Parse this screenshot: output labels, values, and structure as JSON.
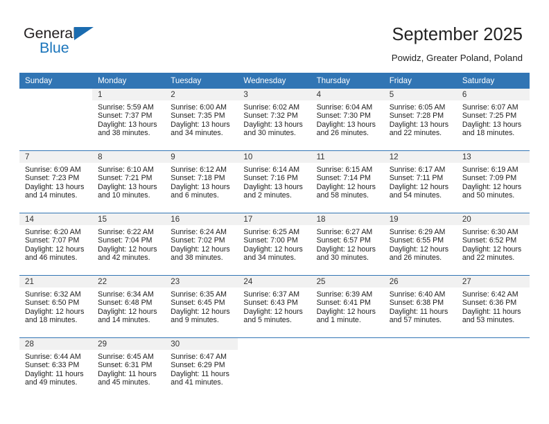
{
  "brand": {
    "name_part1": "General",
    "name_part2": "Blue",
    "logo_icon": "triangle-flag-icon",
    "accent_color": "#1b75bb"
  },
  "header": {
    "title": "September 2025",
    "subtitle": "Powidz, Greater Poland, Poland"
  },
  "calendar": {
    "header_bg_color": "#3175b4",
    "daynum_bg_color": "#f1f1f1",
    "weekday_headers": [
      "Sunday",
      "Monday",
      "Tuesday",
      "Wednesday",
      "Thursday",
      "Friday",
      "Saturday"
    ],
    "weeks": [
      [
        {
          "day": "",
          "sunrise": "",
          "sunset": "",
          "daylight_line1": "",
          "daylight_line2": "",
          "blank": true
        },
        {
          "day": "1",
          "sunrise": "Sunrise: 5:59 AM",
          "sunset": "Sunset: 7:37 PM",
          "daylight_line1": "Daylight: 13 hours",
          "daylight_line2": "and 38 minutes."
        },
        {
          "day": "2",
          "sunrise": "Sunrise: 6:00 AM",
          "sunset": "Sunset: 7:35 PM",
          "daylight_line1": "Daylight: 13 hours",
          "daylight_line2": "and 34 minutes."
        },
        {
          "day": "3",
          "sunrise": "Sunrise: 6:02 AM",
          "sunset": "Sunset: 7:32 PM",
          "daylight_line1": "Daylight: 13 hours",
          "daylight_line2": "and 30 minutes."
        },
        {
          "day": "4",
          "sunrise": "Sunrise: 6:04 AM",
          "sunset": "Sunset: 7:30 PM",
          "daylight_line1": "Daylight: 13 hours",
          "daylight_line2": "and 26 minutes."
        },
        {
          "day": "5",
          "sunrise": "Sunrise: 6:05 AM",
          "sunset": "Sunset: 7:28 PM",
          "daylight_line1": "Daylight: 13 hours",
          "daylight_line2": "and 22 minutes."
        },
        {
          "day": "6",
          "sunrise": "Sunrise: 6:07 AM",
          "sunset": "Sunset: 7:25 PM",
          "daylight_line1": "Daylight: 13 hours",
          "daylight_line2": "and 18 minutes."
        }
      ],
      [
        {
          "day": "7",
          "sunrise": "Sunrise: 6:09 AM",
          "sunset": "Sunset: 7:23 PM",
          "daylight_line1": "Daylight: 13 hours",
          "daylight_line2": "and 14 minutes."
        },
        {
          "day": "8",
          "sunrise": "Sunrise: 6:10 AM",
          "sunset": "Sunset: 7:21 PM",
          "daylight_line1": "Daylight: 13 hours",
          "daylight_line2": "and 10 minutes."
        },
        {
          "day": "9",
          "sunrise": "Sunrise: 6:12 AM",
          "sunset": "Sunset: 7:18 PM",
          "daylight_line1": "Daylight: 13 hours",
          "daylight_line2": "and 6 minutes."
        },
        {
          "day": "10",
          "sunrise": "Sunrise: 6:14 AM",
          "sunset": "Sunset: 7:16 PM",
          "daylight_line1": "Daylight: 13 hours",
          "daylight_line2": "and 2 minutes."
        },
        {
          "day": "11",
          "sunrise": "Sunrise: 6:15 AM",
          "sunset": "Sunset: 7:14 PM",
          "daylight_line1": "Daylight: 12 hours",
          "daylight_line2": "and 58 minutes."
        },
        {
          "day": "12",
          "sunrise": "Sunrise: 6:17 AM",
          "sunset": "Sunset: 7:11 PM",
          "daylight_line1": "Daylight: 12 hours",
          "daylight_line2": "and 54 minutes."
        },
        {
          "day": "13",
          "sunrise": "Sunrise: 6:19 AM",
          "sunset": "Sunset: 7:09 PM",
          "daylight_line1": "Daylight: 12 hours",
          "daylight_line2": "and 50 minutes."
        }
      ],
      [
        {
          "day": "14",
          "sunrise": "Sunrise: 6:20 AM",
          "sunset": "Sunset: 7:07 PM",
          "daylight_line1": "Daylight: 12 hours",
          "daylight_line2": "and 46 minutes."
        },
        {
          "day": "15",
          "sunrise": "Sunrise: 6:22 AM",
          "sunset": "Sunset: 7:04 PM",
          "daylight_line1": "Daylight: 12 hours",
          "daylight_line2": "and 42 minutes."
        },
        {
          "day": "16",
          "sunrise": "Sunrise: 6:24 AM",
          "sunset": "Sunset: 7:02 PM",
          "daylight_line1": "Daylight: 12 hours",
          "daylight_line2": "and 38 minutes."
        },
        {
          "day": "17",
          "sunrise": "Sunrise: 6:25 AM",
          "sunset": "Sunset: 7:00 PM",
          "daylight_line1": "Daylight: 12 hours",
          "daylight_line2": "and 34 minutes."
        },
        {
          "day": "18",
          "sunrise": "Sunrise: 6:27 AM",
          "sunset": "Sunset: 6:57 PM",
          "daylight_line1": "Daylight: 12 hours",
          "daylight_line2": "and 30 minutes."
        },
        {
          "day": "19",
          "sunrise": "Sunrise: 6:29 AM",
          "sunset": "Sunset: 6:55 PM",
          "daylight_line1": "Daylight: 12 hours",
          "daylight_line2": "and 26 minutes."
        },
        {
          "day": "20",
          "sunrise": "Sunrise: 6:30 AM",
          "sunset": "Sunset: 6:52 PM",
          "daylight_line1": "Daylight: 12 hours",
          "daylight_line2": "and 22 minutes."
        }
      ],
      [
        {
          "day": "21",
          "sunrise": "Sunrise: 6:32 AM",
          "sunset": "Sunset: 6:50 PM",
          "daylight_line1": "Daylight: 12 hours",
          "daylight_line2": "and 18 minutes."
        },
        {
          "day": "22",
          "sunrise": "Sunrise: 6:34 AM",
          "sunset": "Sunset: 6:48 PM",
          "daylight_line1": "Daylight: 12 hours",
          "daylight_line2": "and 14 minutes."
        },
        {
          "day": "23",
          "sunrise": "Sunrise: 6:35 AM",
          "sunset": "Sunset: 6:45 PM",
          "daylight_line1": "Daylight: 12 hours",
          "daylight_line2": "and 9 minutes."
        },
        {
          "day": "24",
          "sunrise": "Sunrise: 6:37 AM",
          "sunset": "Sunset: 6:43 PM",
          "daylight_line1": "Daylight: 12 hours",
          "daylight_line2": "and 5 minutes."
        },
        {
          "day": "25",
          "sunrise": "Sunrise: 6:39 AM",
          "sunset": "Sunset: 6:41 PM",
          "daylight_line1": "Daylight: 12 hours",
          "daylight_line2": "and 1 minute."
        },
        {
          "day": "26",
          "sunrise": "Sunrise: 6:40 AM",
          "sunset": "Sunset: 6:38 PM",
          "daylight_line1": "Daylight: 11 hours",
          "daylight_line2": "and 57 minutes."
        },
        {
          "day": "27",
          "sunrise": "Sunrise: 6:42 AM",
          "sunset": "Sunset: 6:36 PM",
          "daylight_line1": "Daylight: 11 hours",
          "daylight_line2": "and 53 minutes."
        }
      ],
      [
        {
          "day": "28",
          "sunrise": "Sunrise: 6:44 AM",
          "sunset": "Sunset: 6:33 PM",
          "daylight_line1": "Daylight: 11 hours",
          "daylight_line2": "and 49 minutes."
        },
        {
          "day": "29",
          "sunrise": "Sunrise: 6:45 AM",
          "sunset": "Sunset: 6:31 PM",
          "daylight_line1": "Daylight: 11 hours",
          "daylight_line2": "and 45 minutes."
        },
        {
          "day": "30",
          "sunrise": "Sunrise: 6:47 AM",
          "sunset": "Sunset: 6:29 PM",
          "daylight_line1": "Daylight: 11 hours",
          "daylight_line2": "and 41 minutes."
        },
        {
          "day": "",
          "sunrise": "",
          "sunset": "",
          "daylight_line1": "",
          "daylight_line2": "",
          "blank": true
        },
        {
          "day": "",
          "sunrise": "",
          "sunset": "",
          "daylight_line1": "",
          "daylight_line2": "",
          "blank": true
        },
        {
          "day": "",
          "sunrise": "",
          "sunset": "",
          "daylight_line1": "",
          "daylight_line2": "",
          "blank": true
        },
        {
          "day": "",
          "sunrise": "",
          "sunset": "",
          "daylight_line1": "",
          "daylight_line2": "",
          "blank": true
        }
      ]
    ]
  }
}
